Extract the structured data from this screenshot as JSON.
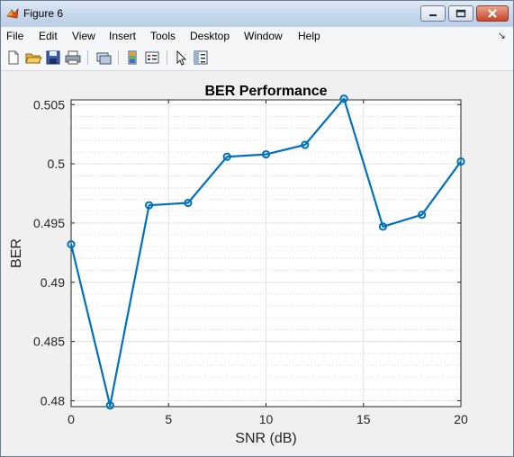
{
  "window": {
    "title": "Figure 6"
  },
  "menu": [
    {
      "label": "File",
      "name": "menu-file"
    },
    {
      "label": "Edit",
      "name": "menu-edit"
    },
    {
      "label": "View",
      "name": "menu-view"
    },
    {
      "label": "Insert",
      "name": "menu-insert"
    },
    {
      "label": "Tools",
      "name": "menu-tools"
    },
    {
      "label": "Desktop",
      "name": "menu-desktop"
    },
    {
      "label": "Window",
      "name": "menu-window"
    },
    {
      "label": "Help",
      "name": "menu-help"
    }
  ],
  "toolbar": [
    "new-figure-icon",
    "open-folder-icon",
    "save-icon",
    "print-icon",
    "link-plot-icon",
    "colorbar-icon",
    "legend-icon",
    "pointer-icon",
    "property-editor-icon"
  ],
  "colors": {
    "line": "#0072bd",
    "grid": "#e3e3e3",
    "minor_grid": "#c8c8c8"
  },
  "chart_data": {
    "type": "line",
    "title": "BER Performance",
    "xlabel": "SNR (dB)",
    "ylabel": "BER",
    "xlim": [
      0,
      20
    ],
    "ylim": [
      0.4795,
      0.5054
    ],
    "xticks": [
      0,
      5,
      10,
      15,
      20
    ],
    "xtick_labels": [
      "0",
      "5",
      "10",
      "15",
      "20"
    ],
    "yticks": [
      0.48,
      0.485,
      0.49,
      0.495,
      0.5,
      0.505
    ],
    "ytick_labels": [
      "0.48",
      "0.485",
      "0.49",
      "0.495",
      "0.5",
      "0.505"
    ],
    "grid": true,
    "minor_grid": true,
    "marker": "circle",
    "series": [
      {
        "x": [
          0,
          2,
          4,
          6,
          8,
          10,
          12,
          14,
          16,
          18,
          20
        ],
        "y": [
          0.4932,
          0.4796,
          0.4965,
          0.4967,
          0.5006,
          0.5008,
          0.5016,
          0.5055,
          0.4947,
          0.4957,
          0.5002
        ]
      }
    ]
  }
}
